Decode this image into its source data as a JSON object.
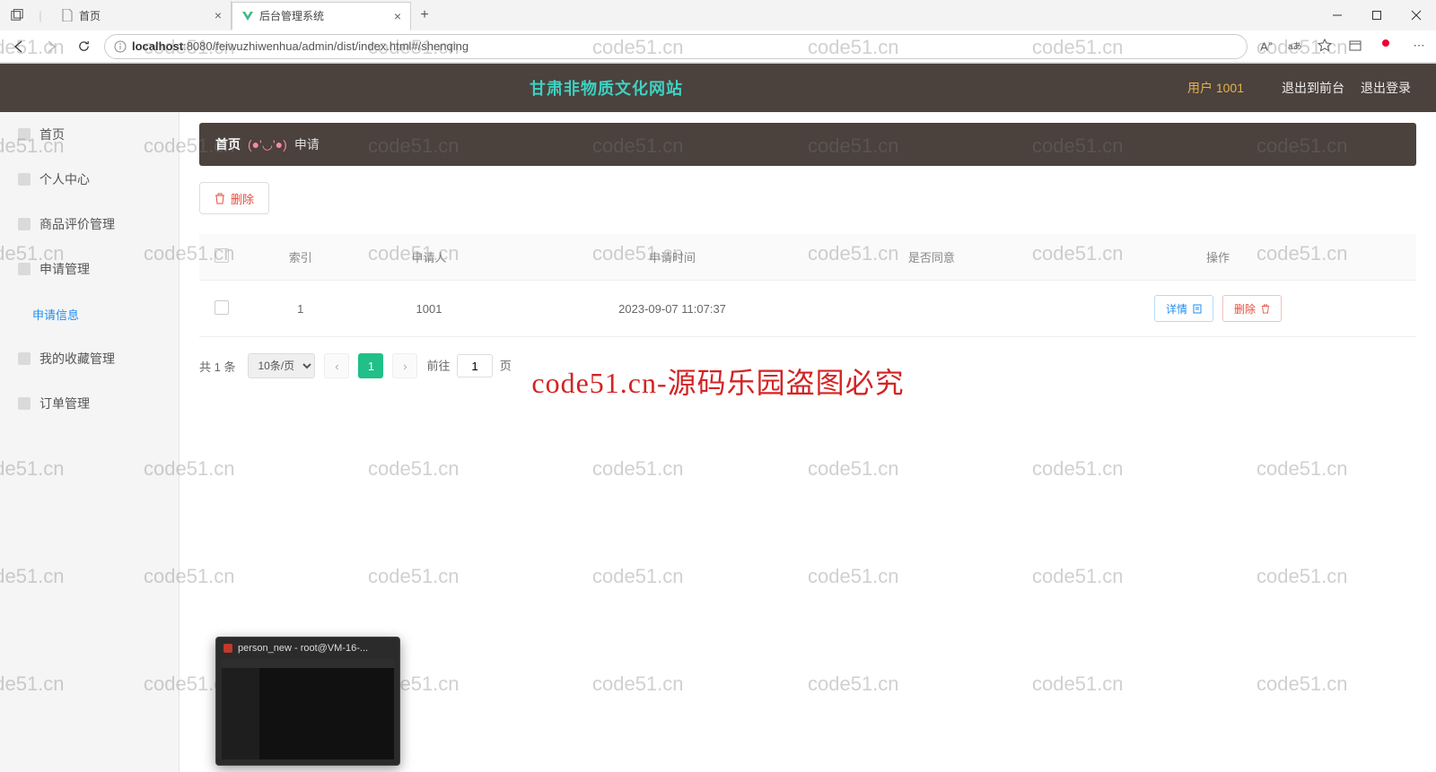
{
  "browser": {
    "tabs": [
      {
        "label": "首页",
        "active": false
      },
      {
        "label": "后台管理系统",
        "active": true
      }
    ],
    "url_host": "localhost",
    "url_port_path": ":8080/feiwuzhiwenhua/admin/dist/index.html#/shenqing"
  },
  "header": {
    "site_title": "甘肃非物质文化网站",
    "user_label": "用户 1001",
    "link_front": "退出到前台",
    "link_logout": "退出登录"
  },
  "sidebar": {
    "items": [
      {
        "label": "首页"
      },
      {
        "label": "个人中心"
      },
      {
        "label": "商品评价管理"
      },
      {
        "label": "申请管理"
      },
      {
        "label": "申请信息",
        "sub": true,
        "active": true
      },
      {
        "label": "我的收藏管理"
      },
      {
        "label": "订单管理"
      }
    ]
  },
  "breadcrumb": {
    "home": "首页",
    "face": "(●'◡'●)",
    "current": "申请"
  },
  "toolbar": {
    "delete_label": "删除"
  },
  "table": {
    "headers": {
      "index": "索引",
      "applicant": "申请人",
      "apply_time": "申请时间",
      "agree": "是否同意",
      "ops": "操作"
    },
    "rows": [
      {
        "index": "1",
        "applicant": "1001",
        "apply_time": "2023-09-07 11:07:37",
        "agree": ""
      }
    ],
    "detail_label": "详情",
    "delete_label": "删除"
  },
  "pagination": {
    "total_text": "共 1 条",
    "page_size": "10条/页",
    "current_page": "1",
    "jump_prefix": "前往",
    "jump_value": "1",
    "jump_suffix": "页"
  },
  "watermark": {
    "text": "code51.cn",
    "big": "code51.cn-源码乐园盗图必究"
  },
  "task_thumb": {
    "title": "person_new - root@VM-16-..."
  }
}
